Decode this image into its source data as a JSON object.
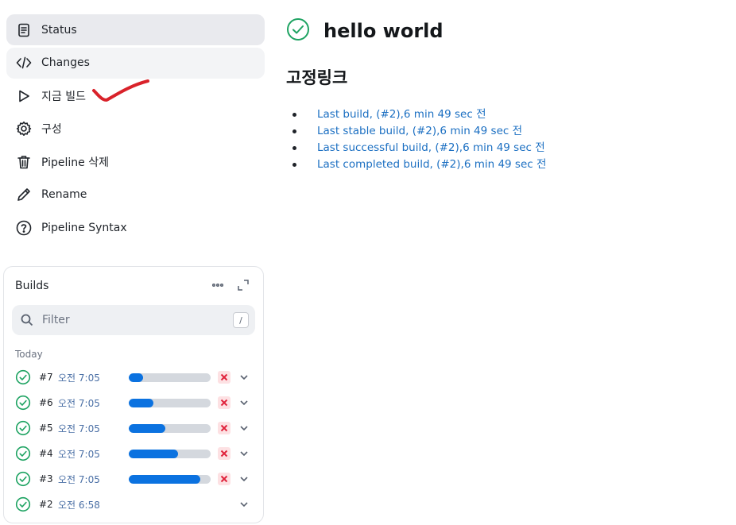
{
  "nav": {
    "items": [
      {
        "label": "Status",
        "icon": "document-icon"
      },
      {
        "label": "Changes",
        "icon": "code-icon"
      },
      {
        "label": "지금 빌드",
        "icon": "play-icon"
      },
      {
        "label": "구성",
        "icon": "gear-icon"
      },
      {
        "label": "Pipeline 삭제",
        "icon": "trash-icon"
      },
      {
        "label": "Rename",
        "icon": "pencil-icon"
      },
      {
        "label": "Pipeline Syntax",
        "icon": "help-icon"
      }
    ]
  },
  "builds": {
    "title": "Builds",
    "filter_placeholder": "Filter",
    "filter_shortcut": "/",
    "group_label": "Today",
    "rows": [
      {
        "number": "#7",
        "time": "오전 7:05",
        "progress": 0.17,
        "running": true
      },
      {
        "number": "#6",
        "time": "오전 7:05",
        "progress": 0.3,
        "running": true
      },
      {
        "number": "#5",
        "time": "오전 7:05",
        "progress": 0.45,
        "running": true
      },
      {
        "number": "#4",
        "time": "오전 7:05",
        "progress": 0.6,
        "running": true
      },
      {
        "number": "#3",
        "time": "오전 7:05",
        "progress": 0.87,
        "running": true
      },
      {
        "number": "#2",
        "time": "오전 6:58",
        "progress": null,
        "running": false
      }
    ]
  },
  "main": {
    "title": "hello world",
    "section_title": "고정링크",
    "permalinks": [
      "Last build, (#2),6 min 49 sec 전",
      "Last stable build, (#2),6 min 49 sec 전",
      "Last successful build, (#2),6 min 49 sec 전",
      "Last completed build, (#2),6 min 49 sec 전"
    ]
  },
  "colors": {
    "success": "#1ea362",
    "link": "#1b6fc2",
    "progress": "#0b72e0",
    "annotation": "#d9222a"
  }
}
